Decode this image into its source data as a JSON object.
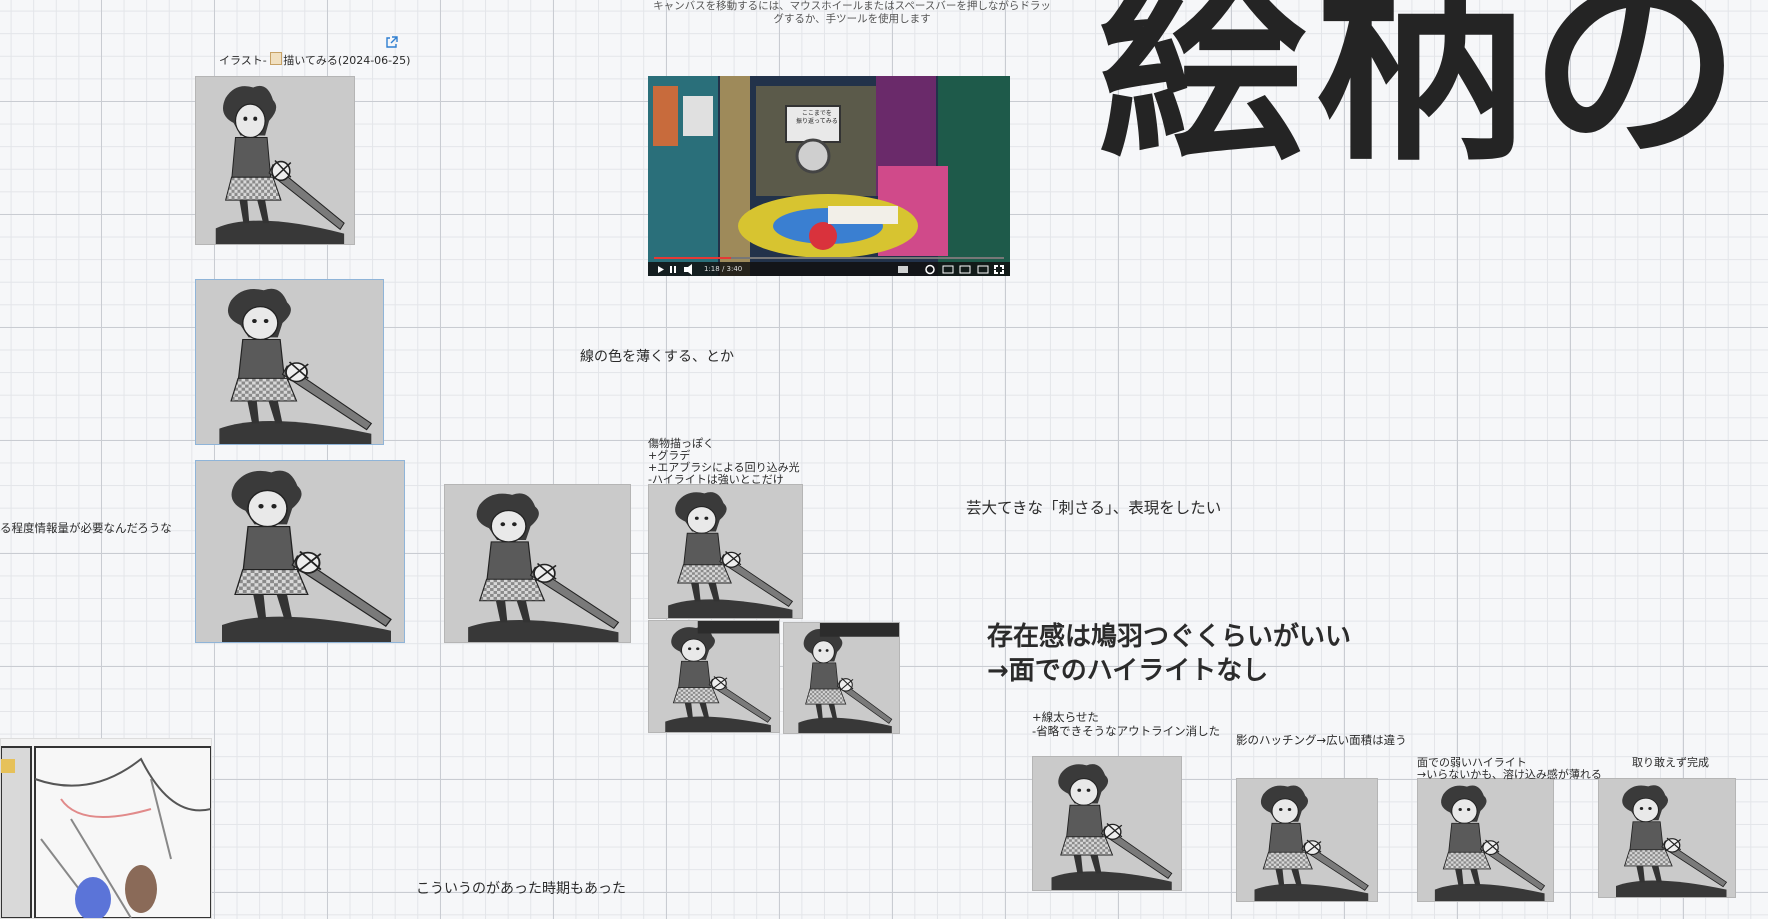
{
  "canvas": {
    "hint": "キャンバスを移動するには、マウスホイールまたはスペースバーを押しながらドラッグするか、手ツールを使用します",
    "big_title": "絵柄の"
  },
  "link_card": {
    "label": "イラスト- 描いてみる(2024-06-25)",
    "doc_icon": "document-icon",
    "external_icon": "external-link-icon"
  },
  "notes": {
    "line_color": "線の色を薄くする、とか",
    "info_amount": "る程度情報量が必要なんだろうな",
    "gradient_note": [
      "傷物描っぽく",
      "+グラデ",
      "+エアブラシによる回り込み光",
      "-ハイライトは強いとこだけ"
    ],
    "expression": "芸大てきな「刺さる」、表現をしたい",
    "presence_1": "存在感は鳩羽つぐくらいがいい",
    "presence_2": "→面でのハイライトなし",
    "thicker_lines": [
      "+線太らせた",
      "-省略できそうなアウトライン消した"
    ],
    "hatching": "影のハッチング→広い面積は違う",
    "weak_highlight": [
      "面での弱いハイライト",
      "→いらないかも、溶け込み感が薄れる"
    ],
    "done": "取り敢えず完成",
    "era": "こういうのがあった時期もあった"
  },
  "video": {
    "time": "1:18 / 3:40",
    "progress": 0.22,
    "screen_text": [
      "ここまでを",
      "振り返ってみる"
    ]
  },
  "colors": {
    "accent": "#2f7fd1",
    "progress_red": "#e53935",
    "frame_gray": "#c9c9c9",
    "title": "#242424"
  }
}
